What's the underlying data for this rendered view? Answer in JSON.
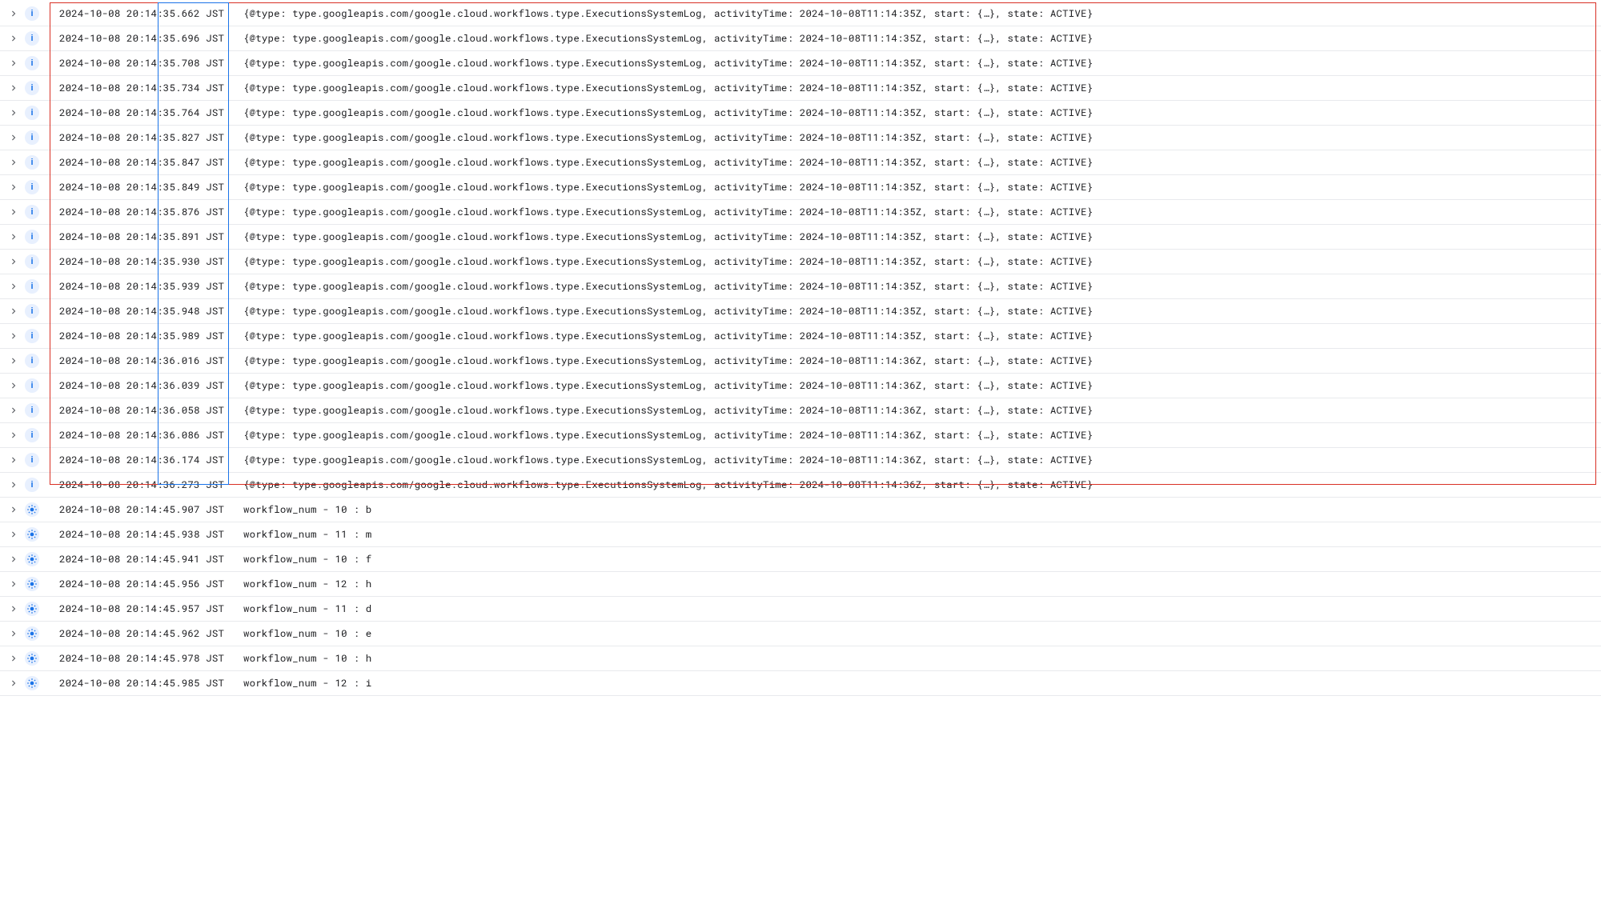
{
  "severity_labels": {
    "info": "i",
    "debug": "debug"
  },
  "message_template_system": "{@type: type.googleapis.com/google.cloud.workflows.type.ExecutionsSystemLog, activityTime: {ACT}, start: {…}, state: ACTIVE}",
  "rows": [
    {
      "sev": "info",
      "ts": "2024-10-08 20:14:35.662 JST",
      "act": "2024-10-08T11:14:35Z"
    },
    {
      "sev": "info",
      "ts": "2024-10-08 20:14:35.696 JST",
      "act": "2024-10-08T11:14:35Z"
    },
    {
      "sev": "info",
      "ts": "2024-10-08 20:14:35.708 JST",
      "act": "2024-10-08T11:14:35Z"
    },
    {
      "sev": "info",
      "ts": "2024-10-08 20:14:35.734 JST",
      "act": "2024-10-08T11:14:35Z"
    },
    {
      "sev": "info",
      "ts": "2024-10-08 20:14:35.764 JST",
      "act": "2024-10-08T11:14:35Z"
    },
    {
      "sev": "info",
      "ts": "2024-10-08 20:14:35.827 JST",
      "act": "2024-10-08T11:14:35Z"
    },
    {
      "sev": "info",
      "ts": "2024-10-08 20:14:35.847 JST",
      "act": "2024-10-08T11:14:35Z"
    },
    {
      "sev": "info",
      "ts": "2024-10-08 20:14:35.849 JST",
      "act": "2024-10-08T11:14:35Z"
    },
    {
      "sev": "info",
      "ts": "2024-10-08 20:14:35.876 JST",
      "act": "2024-10-08T11:14:35Z"
    },
    {
      "sev": "info",
      "ts": "2024-10-08 20:14:35.891 JST",
      "act": "2024-10-08T11:14:35Z"
    },
    {
      "sev": "info",
      "ts": "2024-10-08 20:14:35.930 JST",
      "act": "2024-10-08T11:14:35Z"
    },
    {
      "sev": "info",
      "ts": "2024-10-08 20:14:35.939 JST",
      "act": "2024-10-08T11:14:35Z"
    },
    {
      "sev": "info",
      "ts": "2024-10-08 20:14:35.948 JST",
      "act": "2024-10-08T11:14:35Z"
    },
    {
      "sev": "info",
      "ts": "2024-10-08 20:14:35.989 JST",
      "act": "2024-10-08T11:14:35Z"
    },
    {
      "sev": "info",
      "ts": "2024-10-08 20:14:36.016 JST",
      "act": "2024-10-08T11:14:36Z"
    },
    {
      "sev": "info",
      "ts": "2024-10-08 20:14:36.039 JST",
      "act": "2024-10-08T11:14:36Z"
    },
    {
      "sev": "info",
      "ts": "2024-10-08 20:14:36.058 JST",
      "act": "2024-10-08T11:14:36Z"
    },
    {
      "sev": "info",
      "ts": "2024-10-08 20:14:36.086 JST",
      "act": "2024-10-08T11:14:36Z"
    },
    {
      "sev": "info",
      "ts": "2024-10-08 20:14:36.174 JST",
      "act": "2024-10-08T11:14:36Z"
    },
    {
      "sev": "info",
      "ts": "2024-10-08 20:14:36.273 JST",
      "act": "2024-10-08T11:14:36Z"
    },
    {
      "sev": "debug",
      "ts": "2024-10-08 20:14:45.907 JST",
      "msg": "workflow_num - 10 : b"
    },
    {
      "sev": "debug",
      "ts": "2024-10-08 20:14:45.938 JST",
      "msg": "workflow_num - 11 : m"
    },
    {
      "sev": "debug",
      "ts": "2024-10-08 20:14:45.941 JST",
      "msg": "workflow_num - 10 : f"
    },
    {
      "sev": "debug",
      "ts": "2024-10-08 20:14:45.956 JST",
      "msg": "workflow_num - 12 : h"
    },
    {
      "sev": "debug",
      "ts": "2024-10-08 20:14:45.957 JST",
      "msg": "workflow_num - 11 : d"
    },
    {
      "sev": "debug",
      "ts": "2024-10-08 20:14:45.962 JST",
      "msg": "workflow_num - 10 : e"
    },
    {
      "sev": "debug",
      "ts": "2024-10-08 20:14:45.978 JST",
      "msg": "workflow_num - 10 : h"
    },
    {
      "sev": "debug",
      "ts": "2024-10-08 20:14:45.985 JST",
      "msg": "workflow_num - 12 : i"
    }
  ]
}
